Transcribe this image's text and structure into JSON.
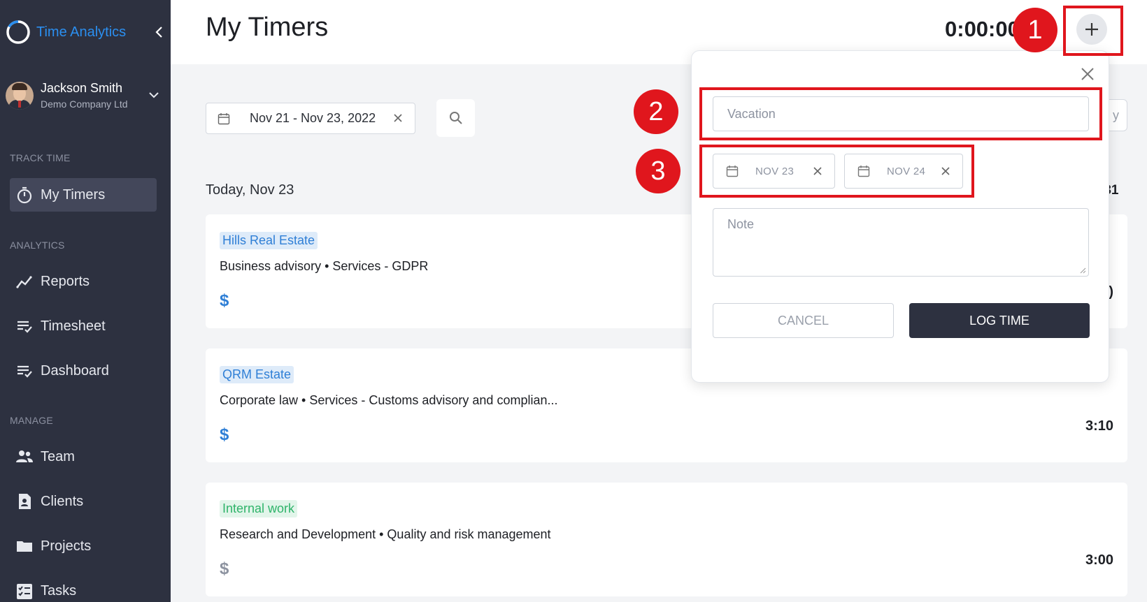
{
  "app": {
    "name": "Time Analytics"
  },
  "user": {
    "name": "Jackson Smith",
    "company": "Demo Company Ltd"
  },
  "sidebar": {
    "sections": [
      {
        "label": "TRACK TIME"
      },
      {
        "label": "ANALYTICS"
      },
      {
        "label": "MANAGE"
      }
    ],
    "items": [
      {
        "label": "My Timers",
        "icon": "stopwatch-icon",
        "active": true
      },
      {
        "label": "Reports",
        "icon": "trend-chart-icon"
      },
      {
        "label": "Timesheet",
        "icon": "list-check-icon"
      },
      {
        "label": "Dashboard",
        "icon": "list-check-icon"
      },
      {
        "label": "Team",
        "icon": "people-icon"
      },
      {
        "label": "Clients",
        "icon": "contact-card-icon"
      },
      {
        "label": "Projects",
        "icon": "folder-icon"
      },
      {
        "label": "Tasks",
        "icon": "task-list-icon"
      }
    ]
  },
  "header": {
    "title": "My Timers",
    "timer": "0:00:00"
  },
  "filter": {
    "date_range": "Nov 21  -  Nov 23, 2022",
    "partial_button_text": "y"
  },
  "day": {
    "label": "Today, Nov 23",
    "total": ":31"
  },
  "entries": [
    {
      "client": "Hills Real Estate",
      "tag_color": "#2f7fd6",
      "description": "Business advisory • Services - GDPR",
      "billable": true,
      "time": ")"
    },
    {
      "client": "QRM Estate",
      "tag_color": "#2f7fd6",
      "description": "Corporate law • Services - Customs advisory and complian...",
      "billable": true,
      "time": "3:10"
    },
    {
      "client": "Internal work",
      "tag_color": "#2fb46a",
      "description": "Research and Development • Quality and risk management",
      "billable": false,
      "time": "3:00"
    }
  ],
  "dollar_symbol": "$",
  "popup": {
    "task_placeholder": "Vacation",
    "date_start": "NOV 23",
    "date_end": "NOV 24",
    "note_placeholder": "Note",
    "cancel_label": "CANCEL",
    "log_label": "LOG TIME"
  },
  "annotations": {
    "marker_1": "1",
    "marker_2": "2",
    "marker_3": "3",
    "color": "#e0161d"
  },
  "colors": {
    "sidebar_bg": "#2d3140",
    "accent": "#2b8ff0",
    "log_button": "#2d3140"
  }
}
